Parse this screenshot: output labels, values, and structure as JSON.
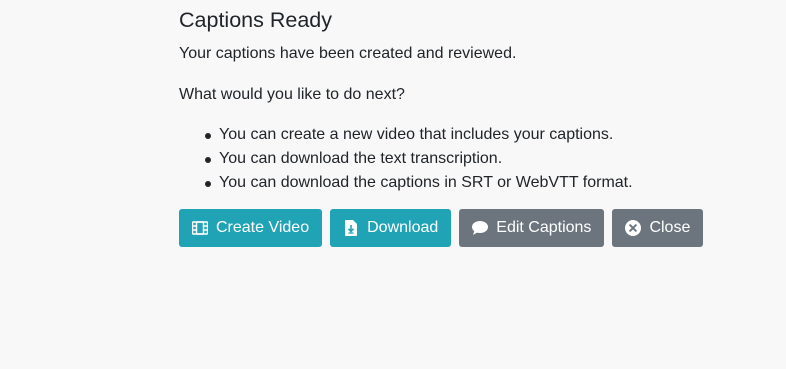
{
  "dialog": {
    "title": "Captions Ready",
    "subtitle": "Your captions have been created and reviewed.",
    "question": "What would you like to do next?",
    "options": [
      "You can create a new video that includes your captions.",
      "You can download the text transcription.",
      "You can download the captions in SRT or WebVTT format."
    ]
  },
  "buttons": {
    "create_video": {
      "label": "Create Video",
      "icon": "film-icon",
      "color": "#21a3b6"
    },
    "download": {
      "label": "Download",
      "icon": "file-download-icon",
      "color": "#21a3b6"
    },
    "edit_captions": {
      "label": "Edit Captions",
      "icon": "comment-icon",
      "color": "#6c757d"
    },
    "close": {
      "label": "Close",
      "icon": "times-circle-icon",
      "color": "#6c757d"
    }
  }
}
